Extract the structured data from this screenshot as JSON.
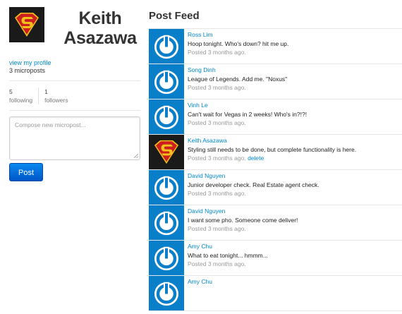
{
  "profile": {
    "name": "Keith Asazawa",
    "view_profile_link": "view my profile",
    "microposts_count": "3 microposts",
    "avatar": "superman-logo-avatar"
  },
  "stats": {
    "following_count": "5",
    "following_label": "following",
    "followers_count": "1",
    "followers_label": "followers"
  },
  "compose": {
    "placeholder": "Compose new micropost...",
    "post_button": "Post"
  },
  "feed": {
    "title": "Post Feed",
    "items": [
      {
        "author": "Ross Lim",
        "content": "Hoop tonight. Who's down? hit me up.",
        "time": "Posted 3 months ago.",
        "avatar": "default-avatar"
      },
      {
        "author": "Song Dinh",
        "content": "League of Legends. Add me. \"Noxus\"",
        "time": "Posted 3 months ago.",
        "avatar": "default-avatar"
      },
      {
        "author": "Vinh Le",
        "content": "Can't wait for Vegas in 2 weeks! Who's in?!?!",
        "time": "Posted 3 months ago.",
        "avatar": "default-avatar"
      },
      {
        "author": "Keith Asazawa",
        "content": "Styling still needs to be done, but complete functionality is here.",
        "time": "Posted 3 months ago.",
        "delete_label": "delete",
        "avatar": "superman-logo-avatar"
      },
      {
        "author": "David Nguyen",
        "content": "Junior developer check. Real Estate agent check.",
        "time": "Posted 3 months ago.",
        "avatar": "default-avatar"
      },
      {
        "author": "David Nguyen",
        "content": "I want some pho. Someone come deliver!",
        "time": "Posted 3 months ago.",
        "avatar": "default-avatar"
      },
      {
        "author": "Amy Chu",
        "content": "What to eat tonight... hmmm...",
        "time": "Posted 3 months ago.",
        "avatar": "default-avatar"
      },
      {
        "author": "Amy Chu",
        "content": "",
        "time": "",
        "avatar": "default-avatar"
      }
    ]
  },
  "colors": {
    "link": "#0088cc",
    "default_avatar_bg": "#0a7fc9",
    "post_button": "#0066cc",
    "superman_red": "#cc1f1f",
    "superman_yellow": "#f2c21b"
  }
}
